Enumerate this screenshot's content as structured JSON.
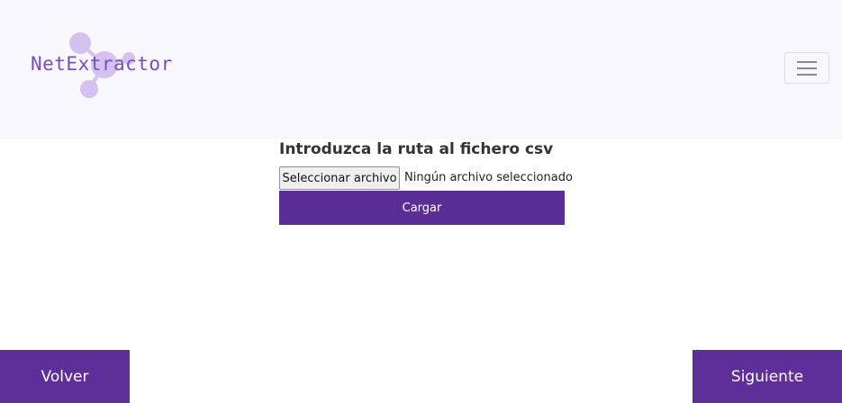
{
  "header": {
    "brand_name": "NetExtractor",
    "logo_icon": "network-nodes-logo",
    "menu_icon": "hamburger-menu-icon"
  },
  "upload_form": {
    "label": "Introduzca la ruta al fichero csv",
    "file_button_label": "Seleccionar archivo",
    "file_status": "Ningún archivo seleccionado",
    "submit_label": "Cargar"
  },
  "footer_nav": {
    "back_label": "Volver",
    "next_label": "Siguiente"
  },
  "colors": {
    "accent": "#5b2d96",
    "brand_text": "#7a4cc0",
    "logo_nodes": "#d3c2ef",
    "navbar_bg": "#f8f7fc"
  }
}
